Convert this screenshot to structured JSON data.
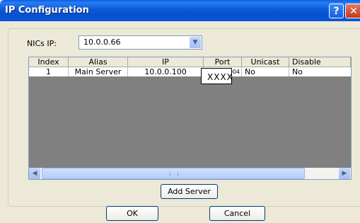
{
  "window": {
    "title": "IP Configuration",
    "help_glyph": "?",
    "close_glyph": "✕"
  },
  "nics": {
    "label": "NICs IP:",
    "selected": "10.0.0.66",
    "dropdown_glyph": "▼"
  },
  "grid": {
    "columns": [
      "Index",
      "Alias",
      "IP",
      "Port",
      "Unicast",
      "Disable"
    ],
    "rows": [
      {
        "index": "1",
        "alias": "Main Server",
        "ip": "10.0.0.100",
        "port": "8004",
        "unicast": "No",
        "disable": "No"
      }
    ],
    "port_edit_value": "XXXX",
    "scroll_left_glyph": "◀",
    "scroll_right_glyph": "▶"
  },
  "buttons": {
    "add_server": "Add Server",
    "ok": "OK",
    "cancel": "Cancel"
  }
}
